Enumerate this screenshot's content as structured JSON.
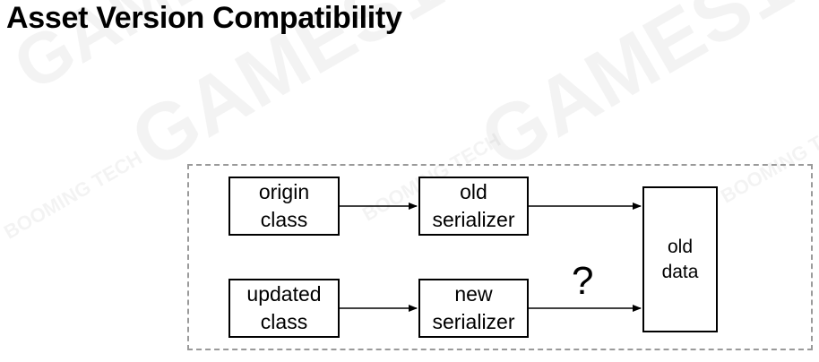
{
  "title": "Asset Version Compatibility",
  "watermarks": {
    "brand": "GAMES104",
    "sub": "BOOMING TECH"
  },
  "diagram": {
    "origin_class": [
      "origin",
      "class"
    ],
    "old_serializer": [
      "old",
      "serializer"
    ],
    "updated_class": [
      "updated",
      "class"
    ],
    "new_serializer": [
      "new",
      "serializer"
    ],
    "old_data": [
      "old",
      "data"
    ],
    "unknown_mark": "?"
  }
}
